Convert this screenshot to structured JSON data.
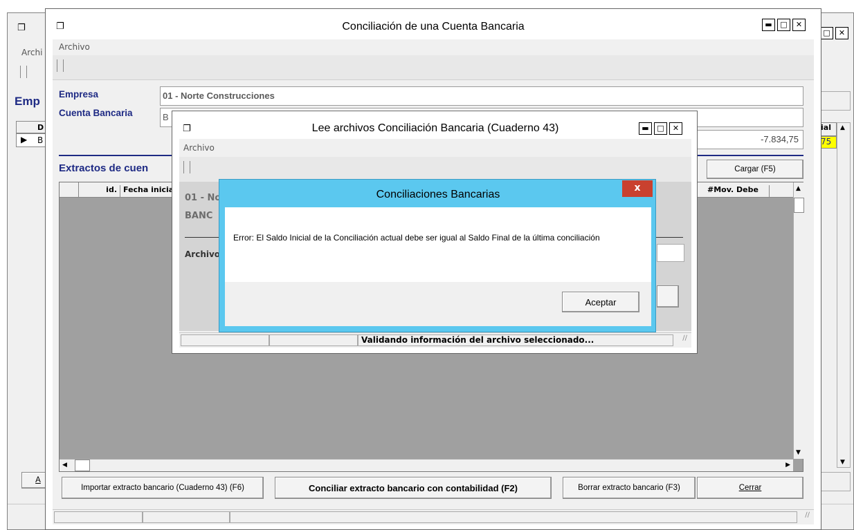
{
  "back_window": {
    "menu": "Archi",
    "heading": "Emp",
    "col_header": "D",
    "row_label": "B",
    "right_header": "ial",
    "right_value": "75",
    "bottom_btn": "A"
  },
  "main_window": {
    "title": "Conciliación de una Cuenta Bancaria",
    "menu": "Archivo",
    "empresa_label": "Empresa",
    "empresa_value": "01 - Norte Construcciones",
    "cuenta_label": "Cuenta Bancaria",
    "cuenta_value": "B",
    "saldo_value": "-7.834,75",
    "extractos_heading": "Extractos de cuen",
    "cargar_button": "Cargar (F5)",
    "columns": [
      "id.",
      "Fecha inicia",
      "#Mov. Debe"
    ],
    "buttons": {
      "importar": "Importar extracto bancario (Cuaderno 43) (F6)",
      "conciliar": "Conciliar extracto bancario con contabilidad (F2)",
      "borrar": "Borrar extracto bancario (F3)",
      "cerrar": "Cerrar"
    }
  },
  "lee_window": {
    "title": "Lee archivos Conciliación Bancaria (Cuaderno 43)",
    "menu": "Archivo",
    "line1": "01 - No",
    "line2": "BANC",
    "archivo_label": "Archivo",
    "status": "Validando información del archivo seleccionado..."
  },
  "dialog": {
    "title": "Conciliaciones Bancarias",
    "close": "x",
    "message": "Error: El Saldo Inicial de la Conciliación actual debe ser igual al Saldo Final de la última conciliación",
    "ok_button": "Aceptar"
  },
  "colors": {
    "dialog_title": "#5bc8ef",
    "close_red": "#c9412f",
    "label_blue": "#1e2a84",
    "highlight": "#ffff00"
  }
}
